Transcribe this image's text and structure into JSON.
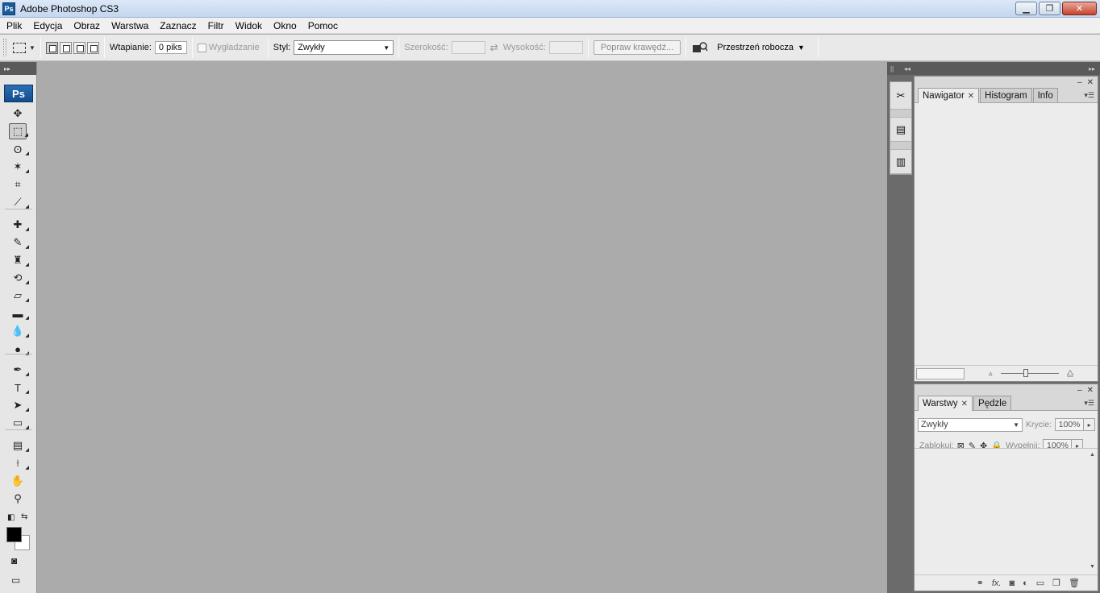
{
  "window": {
    "title": "Adobe Photoshop CS3",
    "app_icon_text": "Ps",
    "controls": [
      "minimize",
      "restore",
      "close"
    ]
  },
  "menu": [
    "Plik",
    "Edycja",
    "Obraz",
    "Warstwa",
    "Zaznacz",
    "Filtr",
    "Widok",
    "Okno",
    "Pomoc"
  ],
  "options": {
    "feather_label": "Wtapianie:",
    "feather_value": "0 piks",
    "antialias_label": "Wygładzanie",
    "style_label": "Styl:",
    "style_value": "Zwykły",
    "width_label": "Szerokość:",
    "height_label": "Wysokość:",
    "refine_edge": "Popraw krawędź...",
    "workspace": "Przestrzeń robocza"
  },
  "tools": {
    "logo": "Ps",
    "items": [
      {
        "name": "move-tool",
        "glyph": "✥",
        "selected": false
      },
      {
        "name": "rectangular-marquee-tool",
        "glyph": "⬚",
        "selected": true
      },
      {
        "name": "lasso-tool",
        "glyph": "ʘ",
        "selected": false
      },
      {
        "name": "magic-wand-tool",
        "glyph": "✶",
        "selected": false
      },
      {
        "name": "crop-tool",
        "glyph": "⌗",
        "selected": false
      },
      {
        "name": "slice-tool",
        "glyph": "⟋",
        "selected": false
      },
      {
        "name": "healing-brush-tool",
        "glyph": "✚",
        "selected": false
      },
      {
        "name": "brush-tool",
        "glyph": "✎",
        "selected": false
      },
      {
        "name": "clone-stamp-tool",
        "glyph": "♜",
        "selected": false
      },
      {
        "name": "history-brush-tool",
        "glyph": "⟲",
        "selected": false
      },
      {
        "name": "eraser-tool",
        "glyph": "▱",
        "selected": false
      },
      {
        "name": "gradient-tool",
        "glyph": "▬",
        "selected": false
      },
      {
        "name": "blur-tool",
        "glyph": "💧",
        "selected": false
      },
      {
        "name": "dodge-tool",
        "glyph": "●",
        "selected": false
      },
      {
        "name": "pen-tool",
        "glyph": "✒",
        "selected": false
      },
      {
        "name": "type-tool",
        "glyph": "T",
        "selected": false
      },
      {
        "name": "path-selection-tool",
        "glyph": "➤",
        "selected": false
      },
      {
        "name": "rectangle-shape-tool",
        "glyph": "▭",
        "selected": false
      },
      {
        "name": "notes-tool",
        "glyph": "▤",
        "selected": false
      },
      {
        "name": "eyedropper-tool",
        "glyph": "⟊",
        "selected": false
      },
      {
        "name": "hand-tool",
        "glyph": "✋",
        "selected": false
      },
      {
        "name": "zoom-tool",
        "glyph": "⚲",
        "selected": false
      }
    ],
    "foreground_color": "#000000",
    "background_color": "#ffffff"
  },
  "navigator_panel": {
    "tabs": [
      "Nawigator",
      "Histogram",
      "Info"
    ],
    "active_tab": "Nawigator"
  },
  "layers_panel": {
    "tabs": [
      "Warstwy",
      "Pędzle"
    ],
    "active_tab": "Warstwy",
    "blend_mode": "Zwykły",
    "opacity_label": "Krycie:",
    "opacity_value": "100%",
    "lock_label": "Zablokuj:",
    "fill_label": "Wypełnij:",
    "fill_value": "100%"
  },
  "colors": {
    "canvas": "#ababab",
    "dock": "#6b6b6b",
    "panel": "#ececec"
  }
}
